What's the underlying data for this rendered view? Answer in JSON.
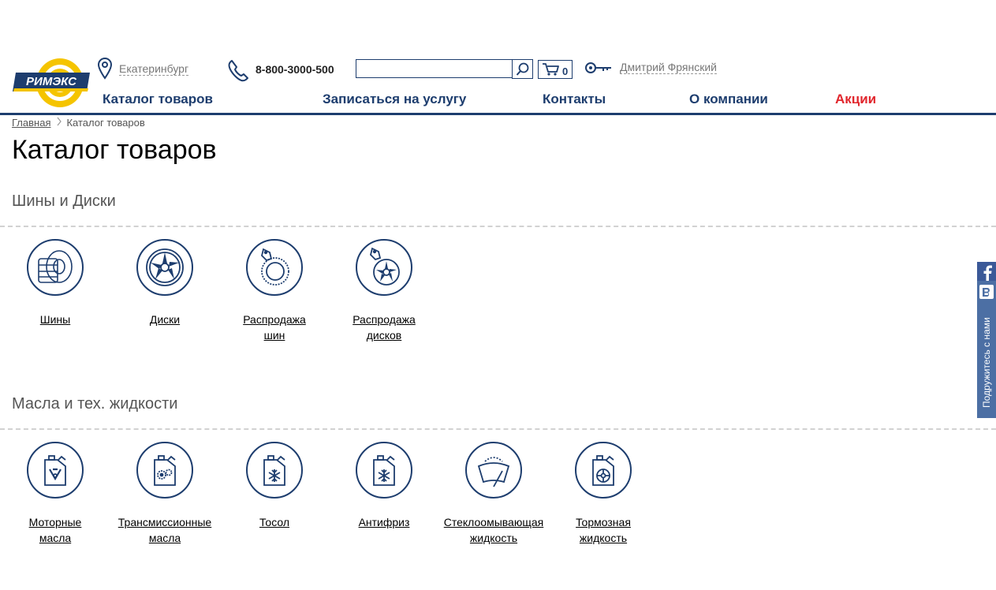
{
  "header": {
    "logo_text": "РИМЭКС",
    "city": "Екатеринбург",
    "phone": "8-800-3000-500",
    "search": {
      "value": "",
      "placeholder": ""
    },
    "cart_count": "0",
    "user_name": "Дмитрий Фрянский",
    "colors": {
      "brand_blue": "#1d3d6e",
      "logo_yellow": "#f5c400",
      "promo_red": "#e1262d"
    }
  },
  "nav": {
    "catalog": "Каталог товаров",
    "service": "Записаться на услугу",
    "contacts": "Контакты",
    "about": "О компании",
    "promo": "Акции"
  },
  "breadcrumb": {
    "home": "Главная",
    "current": "Каталог товаров"
  },
  "page_title": "Каталог товаров",
  "sections": [
    {
      "title": "Шины и Диски",
      "items": [
        {
          "line1": "Шины",
          "line2": "",
          "icon": "tire-stack-icon"
        },
        {
          "line1": "Диски",
          "line2": "",
          "icon": "wheel-rim-icon"
        },
        {
          "line1": "Распродажа",
          "line2": "шин",
          "icon": "tire-sale-icon"
        },
        {
          "line1": "Распродажа",
          "line2": "дисков",
          "icon": "rim-sale-icon"
        }
      ]
    },
    {
      "title": "Масла и тех. жидкости",
      "items": [
        {
          "line1": "Моторные",
          "line2": "масла",
          "icon": "engine-oil-icon"
        },
        {
          "line1": "Трансмиссионные",
          "line2": "масла",
          "icon": "transmission-oil-icon"
        },
        {
          "line1": "Тосол",
          "line2": "",
          "icon": "tosol-icon"
        },
        {
          "line1": "Антифриз",
          "line2": "",
          "icon": "antifreeze-icon"
        },
        {
          "line1": "Стеклоомывающая",
          "line2": "жидкость",
          "icon": "washer-fluid-icon"
        },
        {
          "line1": "Тормозная",
          "line2": "жидкость",
          "icon": "brake-fluid-icon"
        }
      ]
    }
  ],
  "social": {
    "label": "Подружитесь с нами",
    "networks": [
      "facebook-icon",
      "vk-icon"
    ]
  }
}
